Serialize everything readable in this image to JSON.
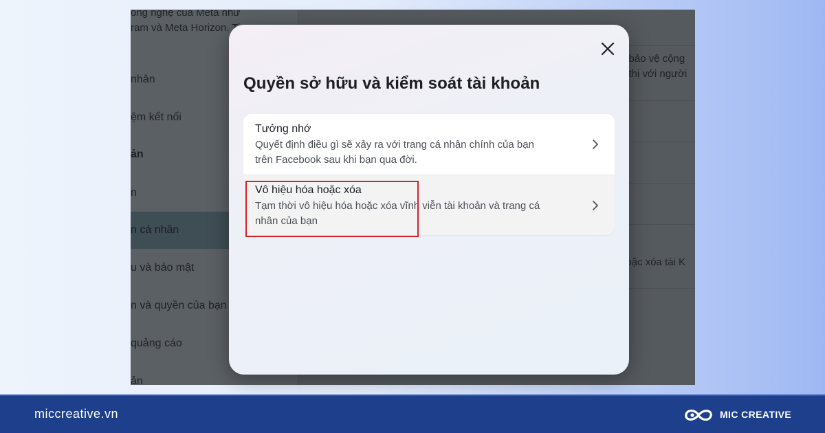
{
  "background": {
    "top_text": [
      "ông nghệ của Meta như",
      "ram và Meta Horizon. Ti"
    ],
    "left_items": [
      {
        "label": "nhân",
        "bold": false,
        "selected": false
      },
      {
        "label": "ệm kết nối",
        "bold": false,
        "selected": false
      },
      {
        "label": "ản",
        "bold": true,
        "selected": false
      },
      {
        "label": "n",
        "bold": false,
        "selected": false
      },
      {
        "label": "n cá nhân",
        "bold": false,
        "selected": true
      },
      {
        "label": "u và bảo mật",
        "bold": false,
        "selected": false
      },
      {
        "label": "n và quyền của bạn",
        "bold": false,
        "selected": false
      },
      {
        "label": "quảng cáo",
        "bold": false,
        "selected": false
      },
      {
        "label": "ản",
        "bold": false,
        "selected": false
      }
    ],
    "right_text": [
      "à bảo vệ cộng",
      "n thị với người",
      "hoặc xóa tài K"
    ]
  },
  "modal": {
    "title": "Quyền sở hữu và kiểm soát tài khoản",
    "close_icon": "close-icon",
    "options": [
      {
        "title": "Tưởng nhớ",
        "description_lines": [
          "Quyết định điều gì sẽ xảy ra với trang cá nhân chính của bạn",
          "trên Facebook sau khi bạn qua đời."
        ]
      },
      {
        "title": "Vô hiệu hóa hoặc xóa",
        "description_lines": [
          "Tạm thời vô hiệu hóa hoặc xóa vĩnh viễn tài khoản và trang cá",
          "nhân của bạn"
        ]
      }
    ]
  },
  "highlight_color": "#d32027",
  "footer": {
    "site": "miccreative.vn",
    "brand": "MIC CREATIVE",
    "logo_icon": "infinity-logo-icon",
    "bg_color": "#1d3f8c"
  }
}
